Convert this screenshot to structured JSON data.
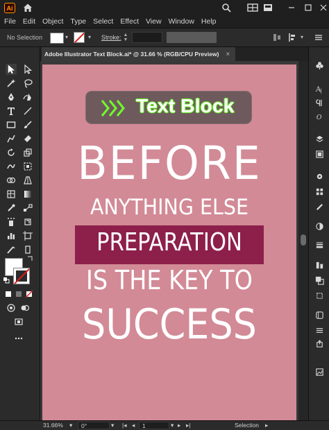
{
  "app": {
    "logo_text": "Ai"
  },
  "menu": [
    "File",
    "Edit",
    "Object",
    "Type",
    "Select",
    "Effect",
    "View",
    "Window",
    "Help"
  ],
  "controlbar": {
    "selection_status": "No Selection",
    "stroke_label": "Stroke:"
  },
  "document": {
    "tab_title": "Adobe Illustrator Text Block.ai* @ 31.66 % (RGB/CPU Preview)",
    "close_glyph": "×"
  },
  "artwork": {
    "badge_text": "Text Block",
    "line1": "BEFORE",
    "line2": "ANYTHING ELSE",
    "line3": "PREPARATION",
    "line4": "IS THE KEY TO",
    "line5": "SUCCESS",
    "colors": {
      "artboard": "#d28a96",
      "highlight": "#8d1f4b",
      "badge_bg": "#6e5a5d",
      "badge_glow": "#6fff2a"
    }
  },
  "statusbar": {
    "zoom": "31.66%",
    "rotation": "0°",
    "artboard_number": "1",
    "mode": "Selection"
  },
  "icons": {
    "titlebar": [
      "home-icon",
      "search-icon",
      "workspace-icon",
      "arrange-icon"
    ],
    "toolbar": [
      "selection-tool-icon",
      "direct-selection-tool-icon",
      "magic-wand-icon",
      "lasso-icon",
      "pen-tool-icon",
      "curvature-icon",
      "type-tool-icon",
      "line-tool-icon",
      "rectangle-tool-icon",
      "paintbrush-icon",
      "shaper-icon",
      "eraser-icon",
      "rotate-icon",
      "scale-icon",
      "warp-icon",
      "free-transform-icon",
      "shape-builder-icon",
      "perspective-icon",
      "mesh-icon",
      "gradient-icon",
      "eyedropper-icon",
      "blend-icon",
      "symbol-sprayer-icon",
      "column-graph-icon",
      "artboard-tool-icon",
      "slice-icon",
      "hand-icon",
      "zoom-icon"
    ]
  }
}
